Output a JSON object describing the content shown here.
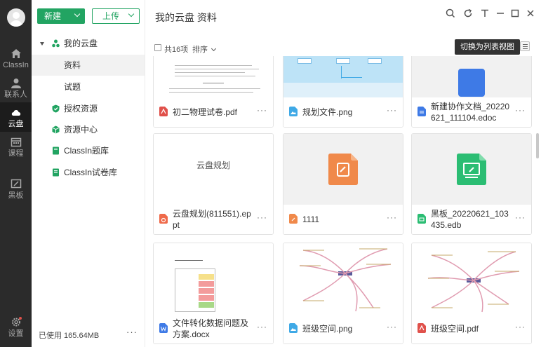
{
  "nav": {
    "items": [
      {
        "label": "ClassIn",
        "icon": "home-icon"
      },
      {
        "label": "联系人",
        "icon": "contacts-icon"
      },
      {
        "label": "云盘",
        "icon": "cloud-icon"
      },
      {
        "label": "课程",
        "icon": "calendar-icon"
      },
      {
        "label": "黑板",
        "icon": "blackboard-icon"
      },
      {
        "label": "设置",
        "icon": "settings-icon"
      }
    ]
  },
  "sidebar": {
    "new_label": "新建",
    "upload_label": "上传",
    "tree": [
      {
        "label": "我的云盘",
        "icon": "team-icon"
      },
      {
        "label": "资料",
        "icon": ""
      },
      {
        "label": "试题",
        "icon": ""
      },
      {
        "label": "授权资源",
        "icon": "shield-icon"
      },
      {
        "label": "资源中心",
        "icon": "cube-icon"
      },
      {
        "label": "ClassIn题库",
        "icon": "book-icon"
      },
      {
        "label": "ClassIn试卷库",
        "icon": "paper-book-icon"
      }
    ],
    "storage": "已使用 165.64MB",
    "more": "···"
  },
  "header": {
    "breadcrumb": "我的云盘  资料"
  },
  "toolbar": {
    "count": "共16项",
    "sort": "排序",
    "tooltip": "切换为列表视图"
  },
  "cards": [
    {
      "name": "初二物理试卷.pdf",
      "type": "pdf"
    },
    {
      "name": "规划文件.png",
      "type": "png"
    },
    {
      "name": "新建协作文档_20220621_111104.edoc",
      "type": "edoc"
    },
    {
      "name": "云盘规划(811551).eppt",
      "type": "eppt",
      "thumb_text": "云盘规划"
    },
    {
      "name": "1111",
      "type": "note"
    },
    {
      "name": "黑板_20220621_103435.edb",
      "type": "edb"
    },
    {
      "name": "文件转化数据问题及方案.docx",
      "type": "docx"
    },
    {
      "name": "班级空间.png",
      "type": "png"
    },
    {
      "name": "班级空间.pdf",
      "type": "pdf"
    }
  ],
  "colors": {
    "brand_green": "#22a462",
    "pdf_red": "#e0514b",
    "png_blue": "#3fa9e6",
    "doc_blue": "#3e7ae6",
    "note_orange": "#f0894a",
    "board_green": "#2bbd73"
  }
}
